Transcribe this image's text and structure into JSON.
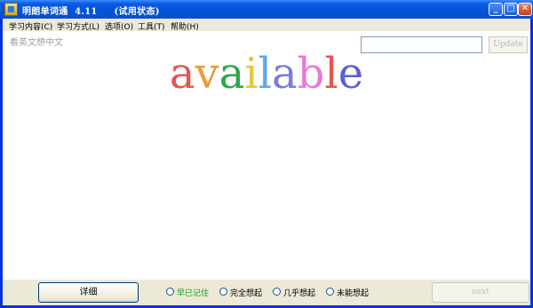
{
  "window": {
    "title": "明朗单词通  4.11     (试用状态)",
    "controls": {
      "minimize": "_",
      "maximize": "□",
      "close": "✕"
    }
  },
  "menu": [
    {
      "label": "学习内容(C)"
    },
    {
      "label": "学习方式(L)"
    },
    {
      "label": "选项(O)"
    },
    {
      "label": "工具(T)"
    },
    {
      "label": "帮助(H)"
    }
  ],
  "main": {
    "hint": "看英文想中文",
    "update_button": "Update",
    "update_input_value": "",
    "word": "available",
    "letter_colors": [
      "#e5554f",
      "#e89b3a",
      "#2aa64a",
      "#e8c53a",
      "#5aa7e8",
      "#7a7dd6",
      "#e87ad6",
      "#e5554f",
      "#5a5ed6"
    ]
  },
  "bottom": {
    "detail_button": "详细",
    "options": [
      {
        "label": "早已记住",
        "color": "#1a9a1a"
      },
      {
        "label": "完全想起",
        "color": "#000000"
      },
      {
        "label": "几乎想起",
        "color": "#000000"
      },
      {
        "label": "未能想起",
        "color": "#000000"
      }
    ],
    "next_button": "next"
  }
}
